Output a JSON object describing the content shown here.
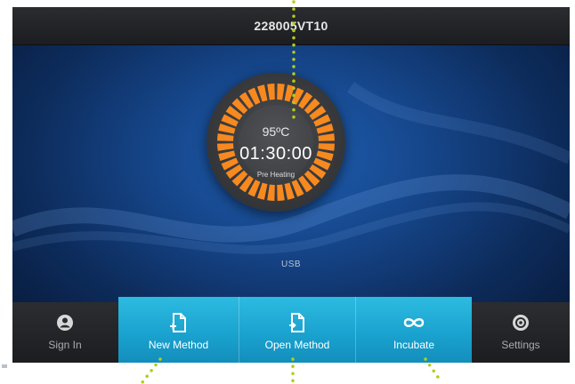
{
  "device": {
    "serial": "228005VT10"
  },
  "dial": {
    "temperature": "95ºC",
    "timer": "01:30:00",
    "status": "Pre Heating"
  },
  "storage_label": "USB",
  "nav": {
    "sign_in": "Sign In",
    "new_method": "New Method",
    "open_method": "Open Method",
    "incubate": "Incubate",
    "settings": "Settings"
  },
  "colors": {
    "accent": "#1aa3cf",
    "ring": "#f7891f",
    "background": "#16478c",
    "bar": "#232427",
    "callout_dots": "#b5cc18"
  },
  "icons": {
    "sign_in": "user-icon",
    "new_method": "new-file-icon",
    "open_method": "open-file-icon",
    "incubate": "infinity-icon",
    "settings": "gear-icon"
  }
}
